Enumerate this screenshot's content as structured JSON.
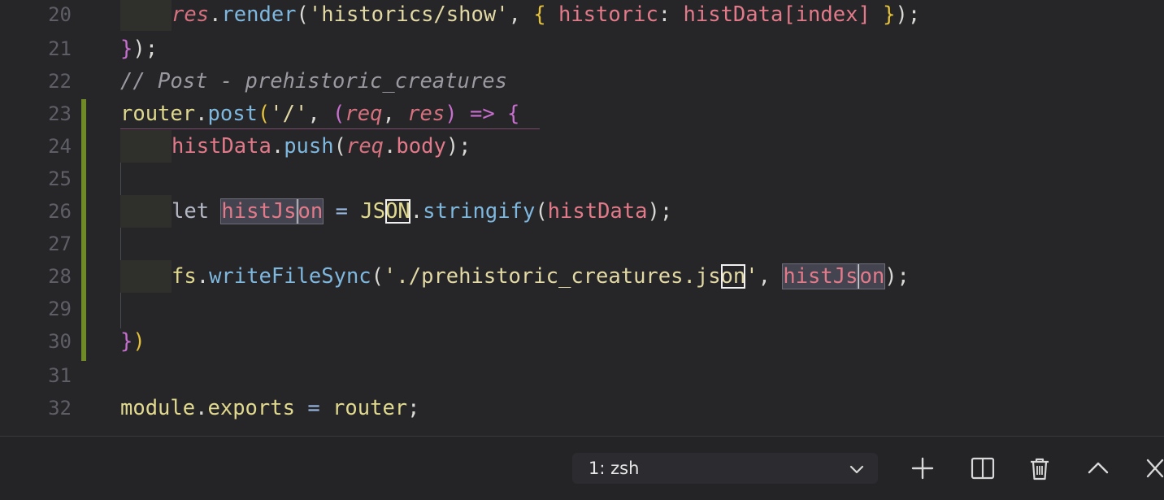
{
  "editor": {
    "lines": [
      {
        "number": "20",
        "tokens": [
          {
            "t": "res",
            "c": "prm"
          },
          {
            "t": ".",
            "c": "plain"
          },
          {
            "t": "render",
            "c": "fn"
          },
          {
            "t": "(",
            "c": "plain"
          },
          {
            "t": "'historics/show'",
            "c": "str"
          },
          {
            "t": ", ",
            "c": "plain"
          },
          {
            "t": "{",
            "c": "b1"
          },
          {
            "t": " historic",
            "c": "var"
          },
          {
            "t": ": ",
            "c": "plain"
          },
          {
            "t": "histData",
            "c": "var"
          },
          {
            "t": "[index]",
            "c": "var"
          },
          {
            "t": " ",
            "c": "plain"
          },
          {
            "t": "}",
            "c": "b1"
          },
          {
            "t": ");",
            "c": "plain"
          }
        ]
      },
      {
        "number": "21",
        "tokens": [
          {
            "t": "}",
            "c": "b2"
          },
          {
            "t": ");",
            "c": "plain"
          }
        ]
      },
      {
        "number": "22",
        "tokens": [
          {
            "t": "// Post - prehistoric_creatures",
            "c": "cm"
          }
        ]
      },
      {
        "number": "23",
        "tokens": [
          {
            "t": "router",
            "c": "cls"
          },
          {
            "t": ".",
            "c": "plain"
          },
          {
            "t": "post",
            "c": "fn"
          },
          {
            "t": "(",
            "c": "b1"
          },
          {
            "t": "'/'",
            "c": "str"
          },
          {
            "t": ", ",
            "c": "plain"
          },
          {
            "t": "(",
            "c": "b2"
          },
          {
            "t": "req",
            "c": "prm"
          },
          {
            "t": ", ",
            "c": "plain"
          },
          {
            "t": "res",
            "c": "prm"
          },
          {
            "t": ")",
            "c": "b2"
          },
          {
            "t": " ",
            "c": "plain"
          },
          {
            "t": "=>",
            "c": "b2"
          },
          {
            "t": " ",
            "c": "plain"
          },
          {
            "t": "{",
            "c": "b2"
          }
        ]
      },
      {
        "number": "24",
        "tokens": [
          {
            "t": "histData",
            "c": "var"
          },
          {
            "t": ".",
            "c": "plain"
          },
          {
            "t": "push",
            "c": "fn"
          },
          {
            "t": "(",
            "c": "plain"
          },
          {
            "t": "req",
            "c": "prm"
          },
          {
            "t": ".",
            "c": "plain"
          },
          {
            "t": "body",
            "c": "var"
          },
          {
            "t": ");",
            "c": "plain"
          }
        ]
      },
      {
        "number": "25",
        "tokens": []
      },
      {
        "number": "26",
        "tokens": [
          {
            "t": "let",
            "c": "kw"
          },
          {
            "t": " ",
            "c": "plain"
          },
          {
            "t": "histJs",
            "c": "var hl"
          },
          {
            "t": "on",
            "c": "var hl caret"
          },
          {
            "t": " ",
            "c": "plain"
          },
          {
            "t": "=",
            "c": "op"
          },
          {
            "t": " ",
            "c": "plain"
          },
          {
            "t": "JS",
            "c": "cls"
          },
          {
            "t": "ON",
            "c": "cls box"
          },
          {
            "t": ".",
            "c": "plain"
          },
          {
            "t": "stringify",
            "c": "fn"
          },
          {
            "t": "(",
            "c": "plain"
          },
          {
            "t": "histData",
            "c": "var"
          },
          {
            "t": ");",
            "c": "plain"
          }
        ]
      },
      {
        "number": "27",
        "tokens": []
      },
      {
        "number": "28",
        "tokens": [
          {
            "t": "fs",
            "c": "cls"
          },
          {
            "t": ".",
            "c": "plain"
          },
          {
            "t": "writeFileSync",
            "c": "fn"
          },
          {
            "t": "(",
            "c": "plain"
          },
          {
            "t": "'./prehistoric_creatures.js",
            "c": "str"
          },
          {
            "t": "on",
            "c": "str box"
          },
          {
            "t": "'",
            "c": "str"
          },
          {
            "t": ", ",
            "c": "plain"
          },
          {
            "t": "histJs",
            "c": "var hl"
          },
          {
            "t": "on",
            "c": "var hl caret"
          },
          {
            "t": ");",
            "c": "plain"
          }
        ]
      },
      {
        "number": "29",
        "tokens": []
      },
      {
        "number": "30",
        "tokens": [
          {
            "t": "}",
            "c": "b2"
          },
          {
            "t": ")",
            "c": "b1"
          }
        ]
      },
      {
        "number": "31",
        "tokens": []
      },
      {
        "number": "32",
        "tokens": [
          {
            "t": "module",
            "c": "cls"
          },
          {
            "t": ".",
            "c": "plain"
          },
          {
            "t": "exports",
            "c": "cls"
          },
          {
            "t": " ",
            "c": "plain"
          },
          {
            "t": "=",
            "c": "op"
          },
          {
            "t": " ",
            "c": "plain"
          },
          {
            "t": "router",
            "c": "cls"
          },
          {
            "t": ";",
            "c": "plain"
          }
        ]
      }
    ]
  },
  "terminal": {
    "selected": "1: zsh",
    "actions": [
      "new-terminal",
      "split-terminal",
      "kill-terminal",
      "maximize-panel",
      "close-panel"
    ]
  },
  "colors": {
    "editor_bg": "#262629",
    "modified_gutter": "#6f8a26"
  }
}
